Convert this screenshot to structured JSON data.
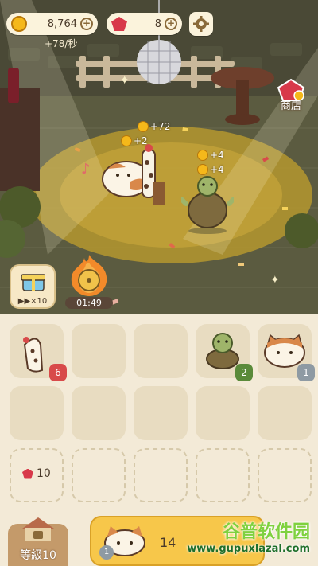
{
  "hud": {
    "coins": "8,764",
    "gems": "8",
    "rate": "+78/秒"
  },
  "shop": {
    "label": "商店"
  },
  "floats": {
    "f1": "+72",
    "f2": "+2",
    "f3": "+4",
    "f4": "+4"
  },
  "boosts": {
    "gift_caption": "▶▶×10",
    "disc_timer": "01:49"
  },
  "grid": {
    "row1": [
      {
        "icon": "giraffe-icon",
        "badge": "6",
        "badge_color": "#d84a4a"
      },
      {
        "icon": "",
        "badge": ""
      },
      {
        "icon": "",
        "badge": ""
      },
      {
        "icon": "turtle-icon",
        "badge": "2",
        "badge_color": "#5a8a3a"
      },
      {
        "icon": "cat-icon",
        "badge": "1",
        "badge_color": "#8e9aa3"
      }
    ],
    "locked_slot_cost": "10"
  },
  "bottom": {
    "level_label": "等級10",
    "buy_price": "14",
    "buy_level": "1"
  },
  "watermark": {
    "title": "谷普软件园",
    "url": "www.gupuxlazal.com"
  }
}
